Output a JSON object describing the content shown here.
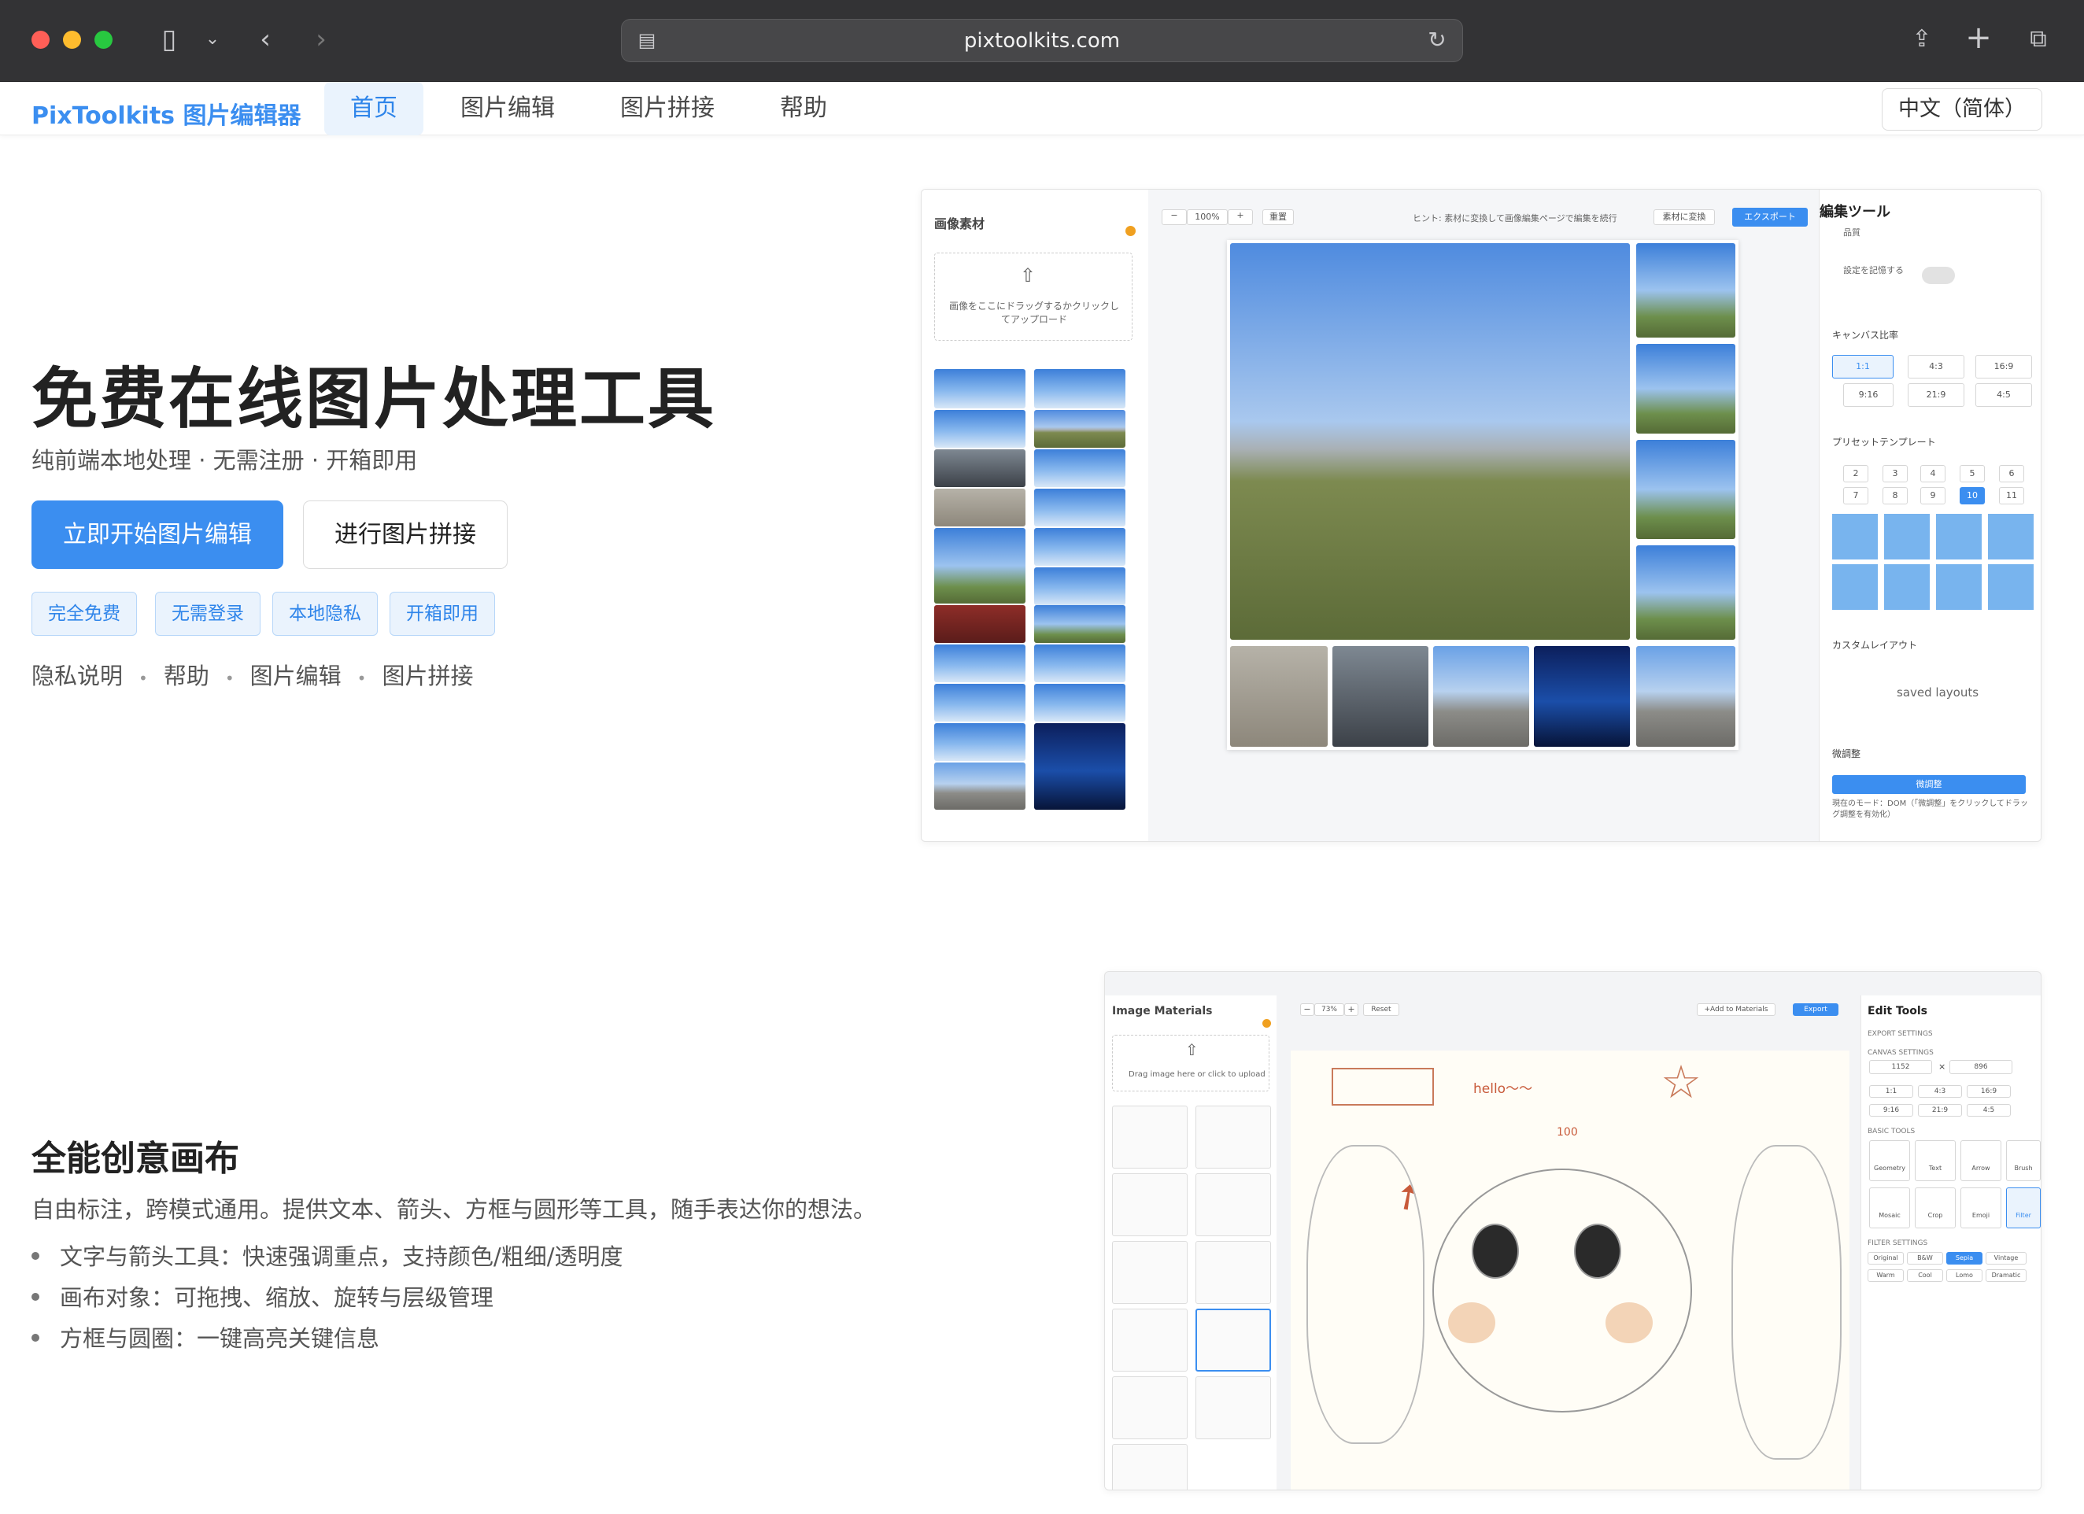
{
  "browser": {
    "url": "pixtoolkits.com"
  },
  "nav": {
    "brand": "PixToolkits 图片编辑器",
    "items": [
      "首页",
      "图片编辑",
      "图片拼接",
      "帮助"
    ],
    "lang": "中文（简体）"
  },
  "hero": {
    "title": "免费在线图片处理工具",
    "subtitle": "纯前端本地处理 · 无需注册 · 开箱即用",
    "primary": "立即开始图片编辑",
    "secondary": "进行图片拼接",
    "tags": [
      "完全免费",
      "无需登录",
      "本地隐私",
      "开箱即用"
    ],
    "links": [
      "隐私说明",
      "帮助",
      "图片编辑",
      "图片拼接"
    ]
  },
  "shot1": {
    "materials": "画像素材",
    "upload": "画像をここにドラッグするかクリックしてアップロード",
    "zoom": "100%",
    "reset": "重置",
    "hint": "ヒント: 素材に変換して画像編集ページで編集を続行",
    "convert": "素材に変換",
    "export": "エクスポート",
    "tools": "編集ツール",
    "quality": "品質",
    "remember": "設定を記憶する",
    "ratio": "キャンバス比率",
    "ratios": [
      "1:1",
      "4:3",
      "16:9",
      "9:16",
      "21:9",
      "4:5"
    ],
    "preset": "プリセットテンプレート",
    "counts": [
      "2",
      "3",
      "4",
      "5",
      "6",
      "7",
      "8",
      "9",
      "10",
      "11"
    ],
    "custom": "カスタムレイアウト",
    "saved": "saved layouts",
    "fine": "微調整",
    "fine_btn": "微調整",
    "mode": "現在のモード：DOM（「微調整」をクリックしてドラッグ調整を有効化）"
  },
  "feature": {
    "title": "全能创意画布",
    "desc": "自由标注，跨模式通用。提供文本、箭头、方框与圆形等工具，随手表达你的想法。",
    "bullets": [
      "文字与箭头工具：快速强调重点，支持颜色/粗细/透明度",
      "画布对象：可拖拽、缩放、旋转与层级管理",
      "方框与圆圈：一键高亮关键信息"
    ]
  },
  "shot2": {
    "materials": "Image Materials",
    "upload": "Drag image here or click to upload",
    "zoom": "73%",
    "reset": "Reset",
    "add": "+Add to Materials",
    "export": "Export",
    "tools": "Edit Tools",
    "export_settings": "EXPORT SETTINGS",
    "canvas_settings": "CANVAS SETTINGS",
    "w": "1152",
    "h": "896",
    "ratios": [
      "1:1",
      "4:3",
      "16:9",
      "9:16",
      "21:9",
      "4:5"
    ],
    "basic": "BASIC TOOLS",
    "tools_list": [
      "Geometry",
      "Text",
      "Arrow",
      "Brush",
      "Mosaic",
      "Crop",
      "Emoji",
      "Filter"
    ],
    "filter_settings": "FILTER SETTINGS",
    "filters": [
      "Original",
      "B&W",
      "Sepia",
      "Vintage",
      "Warm",
      "Cool",
      "Lomo",
      "Dramatic"
    ],
    "hello": "hello～～",
    "num": "100"
  }
}
